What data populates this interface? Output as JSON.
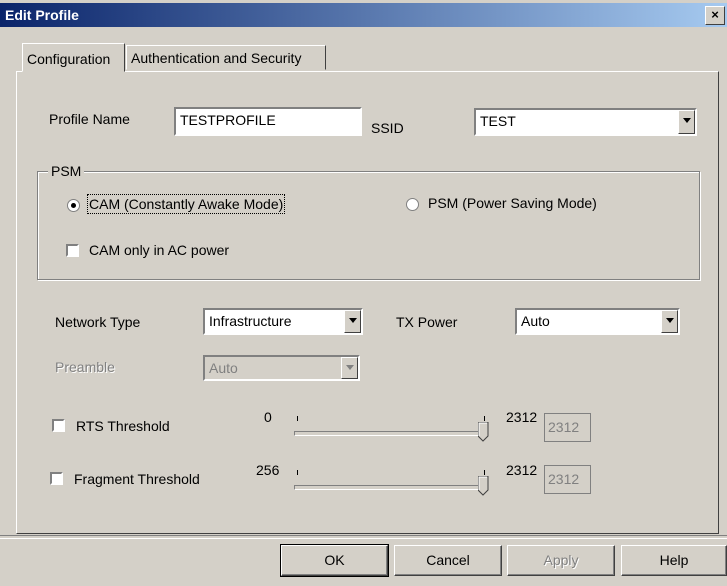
{
  "window": {
    "title": "Edit Profile",
    "close_label": "×"
  },
  "tabs": [
    {
      "label": "Configuration",
      "active": true
    },
    {
      "label": "Authentication and Security",
      "active": false
    }
  ],
  "profile": {
    "profile_name_label": "Profile Name",
    "profile_name_value": "TESTPROFILE",
    "ssid_label": "SSID",
    "ssid_value": "TEST"
  },
  "psm": {
    "group_label": "PSM",
    "cam_label": "CAM (Constantly Awake Mode)",
    "cam_selected": true,
    "psm_label": "PSM (Power Saving Mode)",
    "psm_selected": false,
    "cam_ac_label": "CAM only in AC power",
    "cam_ac_checked": false
  },
  "network": {
    "network_type_label": "Network Type",
    "network_type_value": "Infrastructure",
    "tx_power_label": "TX Power",
    "tx_power_value": "Auto",
    "preamble_label": "Preamble",
    "preamble_value": "Auto",
    "preamble_enabled": false
  },
  "thresholds": {
    "rts": {
      "label": "RTS Threshold",
      "checked": false,
      "min": "0",
      "max": "2312",
      "value": "2312"
    },
    "fragment": {
      "label": "Fragment Threshold",
      "checked": false,
      "min": "256",
      "max": "2312",
      "value": "2312"
    }
  },
  "buttons": {
    "ok": "OK",
    "cancel": "Cancel",
    "apply": "Apply",
    "help": "Help"
  }
}
